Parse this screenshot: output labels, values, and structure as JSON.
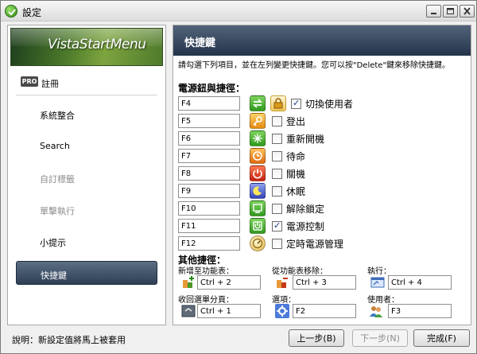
{
  "window": {
    "title": "設定",
    "minimize_label": "—",
    "maximize_label": "□",
    "close_label": "✕"
  },
  "sidebar": {
    "logo_text": "VistaStartMenu",
    "pro_badge": "PRO",
    "items": [
      {
        "label": "註冊",
        "state": "normal"
      },
      {
        "label": "系統整合",
        "state": "normal"
      },
      {
        "label": "Search",
        "state": "normal"
      },
      {
        "label": "自訂標籤",
        "state": "disabled"
      },
      {
        "label": "單擊執行",
        "state": "disabled"
      },
      {
        "label": "小提示",
        "state": "normal"
      },
      {
        "label": "快捷鍵",
        "state": "selected"
      }
    ]
  },
  "panel": {
    "title": "快捷鍵",
    "instructions": "請勾選下列項目，並在左列變更快捷鍵。您可以按\"Delete\"鍵來移除快捷鍵。",
    "power_section_title": "電源鈕與捷徑：",
    "other_section_title": "其他捷徑：",
    "power_hotkeys": [
      {
        "key": "F4",
        "label": "切換使用者",
        "checked": true,
        "icon": "switch-user-icon",
        "color": "#4caf37"
      },
      {
        "key": "F5",
        "label": "登出",
        "checked": false,
        "icon": "logoff-key-icon",
        "color": "#f0a020"
      },
      {
        "key": "F6",
        "label": "重新開機",
        "checked": false,
        "icon": "restart-icon",
        "color": "#3aa83a"
      },
      {
        "key": "F7",
        "label": "待命",
        "checked": false,
        "icon": "standby-icon",
        "color": "#f08a1a"
      },
      {
        "key": "F8",
        "label": "關機",
        "checked": false,
        "icon": "shutdown-icon",
        "color": "#d93a1e"
      },
      {
        "key": "F9",
        "label": "休眠",
        "checked": false,
        "icon": "hibernate-icon",
        "color": "#4a5fd0"
      },
      {
        "key": "F10",
        "label": "解除鎖定",
        "checked": false,
        "icon": "undock-icon",
        "color": "#3aa83a"
      },
      {
        "key": "F11",
        "label": "電源控制",
        "checked": true,
        "icon": "power-control-icon",
        "color": "#3aa83a"
      },
      {
        "key": "F12",
        "label": "定時電源管理",
        "checked": false,
        "icon": "timer-icon",
        "color": "#e8c050"
      }
    ],
    "other_hotkeys": [
      {
        "label": "新增至功能表：",
        "value": "Ctrl + 2",
        "icon": "add-to-menu-icon"
      },
      {
        "label": "從功能表移除：",
        "value": "Ctrl + 3",
        "icon": "remove-from-menu-icon"
      },
      {
        "label": "執行：",
        "value": "Ctrl + 4",
        "icon": "run-icon"
      },
      {
        "label": "收回選單分頁：",
        "value": "Ctrl + 1",
        "icon": "collapse-tab-icon"
      },
      {
        "label": "選項：",
        "value": "F2",
        "icon": "options-gear-icon"
      },
      {
        "label": "使用者：",
        "value": "F3",
        "icon": "users-icon"
      }
    ]
  },
  "footer": {
    "status_text": "說明：新設定值將馬上被套用",
    "prev_label": "上一步(B)",
    "next_label": "下一步(N)",
    "done_label": "完成(F)"
  },
  "colors": {
    "header_dark": "#23334a",
    "header_light": "#53647a",
    "logo_green": "#4c7a2a"
  }
}
